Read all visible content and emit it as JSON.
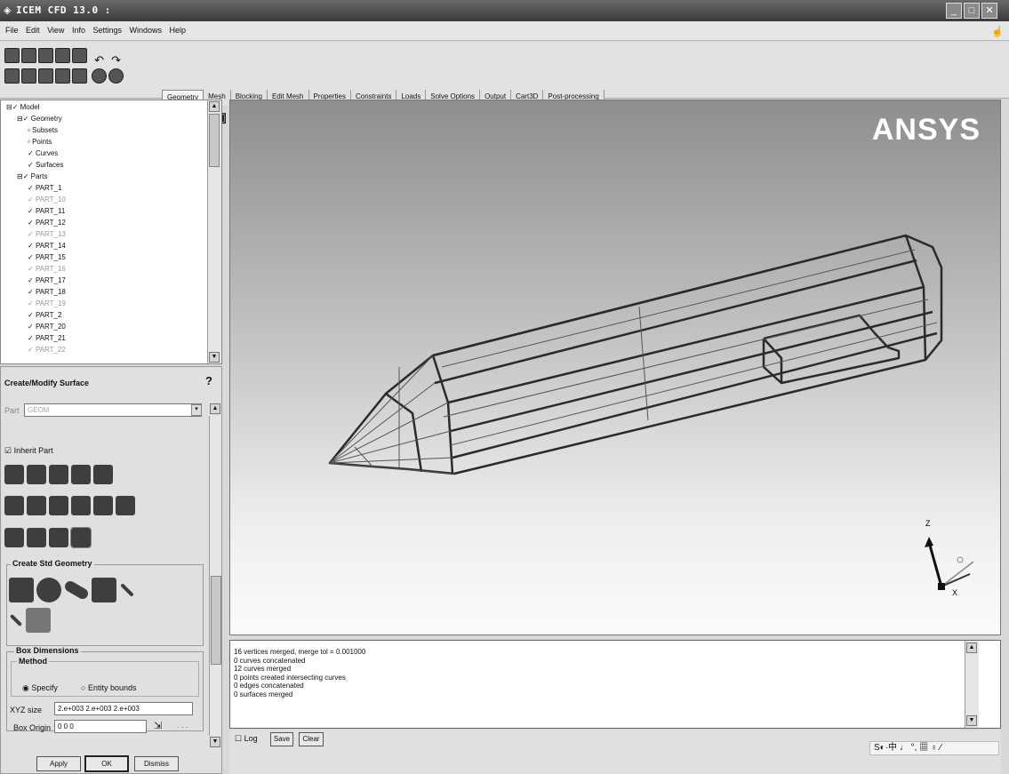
{
  "window": {
    "title": "ICEM CFD 13.0 :"
  },
  "menu": [
    "File",
    "Edit",
    "View",
    "Info",
    "Settings",
    "Windows",
    "Help"
  ],
  "tabs": [
    "Geometry",
    "Mesh",
    "Blocking",
    "Edit Mesh",
    "Properties",
    "Constraints",
    "Loads",
    "Solve Options",
    "Output",
    "Cart3D",
    "Post-processing"
  ],
  "tree": {
    "model": "Model",
    "geometry": "Geometry",
    "subsets": "Subsets",
    "points": "Points",
    "curves": "Curves",
    "surfaces": "Surfaces",
    "parts": "Parts",
    "part_items": [
      "PART_1",
      "PART_10",
      "PART_11",
      "PART_12",
      "PART_13",
      "PART_14",
      "PART_15",
      "PART_16",
      "PART_17",
      "PART_18",
      "PART_19",
      "PART_2",
      "PART_20",
      "PART_21",
      "PART_22"
    ]
  },
  "form": {
    "title": "Create/Modify Surface",
    "help": "?",
    "part_label": "Part",
    "part_value": "GEOM",
    "inherit_part": "Inherit Part",
    "std_geometry": "Create Std Geometry",
    "box_dimensions": "Box Dimensions",
    "method": "Method",
    "specify": "Specify",
    "entity_bounds": "Entity bounds",
    "xyz_label": "XYZ size",
    "xyz_value": "2.e+003 2.e+003 2.e+003",
    "origin_label": "Box Origin",
    "origin_value": "0 0 0",
    "apply": "Apply",
    "ok": "OK",
    "dismiss": "Dismiss"
  },
  "viewport": {
    "logo": "ANSYS",
    "axis_z": "Z",
    "axis_x": "X"
  },
  "messages": [
    "16 vertices merged, merge tol = 0.001000",
    "0 curves concatenated",
    "12 curves merged",
    "0 points created intersecting curves",
    "0 edges concatenated",
    "0 surfaces merged"
  ],
  "status": {
    "log": "Log",
    "save": "Save",
    "clear": "Clear"
  }
}
